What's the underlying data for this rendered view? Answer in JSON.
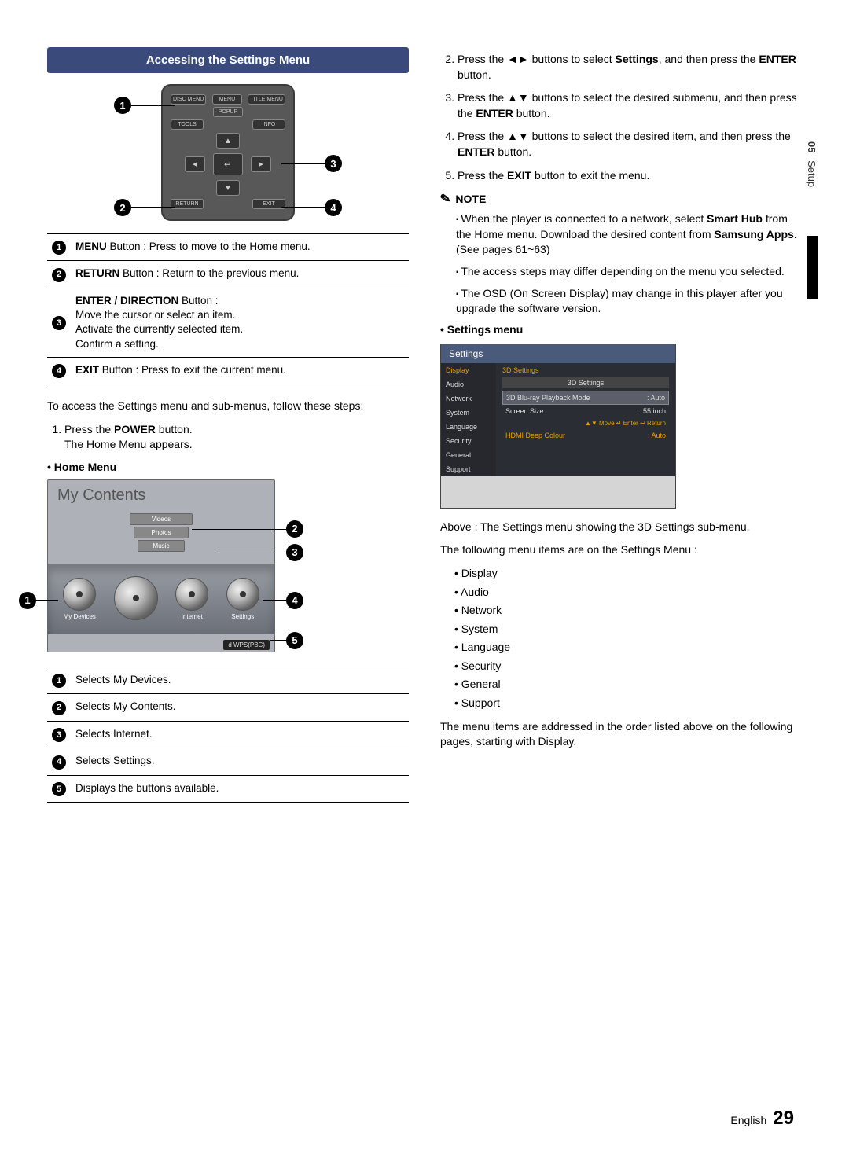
{
  "sideTab": {
    "chapter": "05",
    "title": "Setup"
  },
  "header": "Accessing the Settings Menu",
  "remote": {
    "topRow": [
      "DISC MENU",
      "MENU",
      "TITLE MENU"
    ],
    "row2": [
      "TOOLS",
      "INFO"
    ],
    "row3": [
      "RETURN",
      "EXIT"
    ],
    "popup": "POPUP",
    "center": "↵"
  },
  "remoteCallouts": [
    "1",
    "2",
    "3",
    "4"
  ],
  "remoteTable": [
    {
      "n": "1",
      "bold": "MENU",
      "rest": " Button : Press to move to the Home menu."
    },
    {
      "n": "2",
      "bold": "RETURN",
      "rest": " Button : Return to the previous menu."
    },
    {
      "n": "3",
      "bold": "ENTER / DIRECTION",
      "rest": " Button :",
      "extra": [
        "Move the cursor or select an item.",
        "Activate the currently selected item.",
        "Confirm a setting."
      ]
    },
    {
      "n": "4",
      "bold": "EXIT",
      "rest": " Button : Press to exit the current menu."
    }
  ],
  "intro": "To access the Settings menu and sub-menus, follow these steps:",
  "stepsLeft": [
    {
      "n": "1.",
      "bold": "POWER",
      "pre": "Press the ",
      "post": " button.",
      "line2": "The Home Menu appears."
    }
  ],
  "homeMenuHeading": "Home Menu",
  "homeMenu": {
    "title": "My Contents",
    "cats": [
      "Videos",
      "Photos",
      "Music"
    ],
    "items": [
      "My Devices",
      "",
      "Internet",
      "Settings"
    ],
    "footer": "d WPS(PBC)"
  },
  "homeCallouts": [
    "1",
    "2",
    "3",
    "4",
    "5"
  ],
  "homeTable": [
    {
      "n": "1",
      "t": "Selects My Devices."
    },
    {
      "n": "2",
      "t": "Selects My Contents."
    },
    {
      "n": "3",
      "t": "Selects Internet."
    },
    {
      "n": "4",
      "t": "Selects Settings."
    },
    {
      "n": "5",
      "t": "Displays the buttons available."
    }
  ],
  "stepsRight": [
    {
      "n": "2.",
      "html": "Press the ◄► buttons to select <b>Settings</b>, and then press the <b>ENTER</b> button."
    },
    {
      "n": "3.",
      "html": "Press the ▲▼ buttons to select the desired submenu, and then press the <b>ENTER</b> button."
    },
    {
      "n": "4.",
      "html": "Press the ▲▼ buttons to select the desired item, and then press the <b>ENTER</b> button."
    },
    {
      "n": "5.",
      "html": "Press the <b>EXIT</b> button to exit the menu."
    }
  ],
  "noteLabel": "NOTE",
  "notes": [
    "When the player is connected to a network, select <b>Smart Hub</b> from the Home menu. Download the desired content from <b>Samsung Apps</b>. (See pages 61~63)",
    "The access steps may differ depending on the menu you selected.",
    "The OSD (On Screen Display) may change in this player after you upgrade the software version."
  ],
  "settingsMenuHeading": "Settings menu",
  "settingsShot": {
    "title": "Settings",
    "side": [
      "Display",
      "Audio",
      "Network",
      "System",
      "Language",
      "Security",
      "General",
      "Support"
    ],
    "activeSide": "Display",
    "mainHeader": "3D Settings",
    "subHeader": "3D Settings",
    "rows": [
      {
        "l": "3D Blu-ray Playback Mode",
        "r": ": Auto"
      },
      {
        "l": "Screen Size",
        "r": ": 55   inch"
      }
    ],
    "hints": "▲▼ Move   ↵ Enter   ↩ Return",
    "bottom": {
      "l": "HDMI Deep Colour",
      "r": ": Auto"
    }
  },
  "caption": "Above : The Settings menu showing the 3D Settings sub-menu.",
  "following": "The following menu items are on the Settings Menu :",
  "menuList": [
    "Display",
    "Audio",
    "Network",
    "System",
    "Language",
    "Security",
    "General",
    "Support"
  ],
  "closing": "The menu items are addressed in the order listed above on the following pages, starting with Display.",
  "footer": {
    "lang": "English",
    "page": "29"
  }
}
